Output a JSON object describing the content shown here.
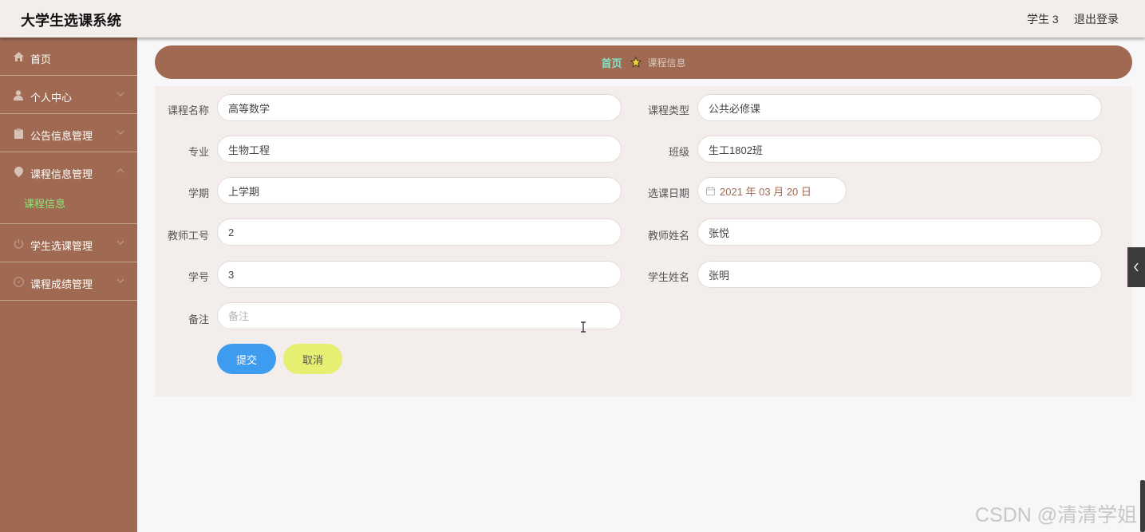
{
  "header": {
    "app_title": "大学生选课系统",
    "user_name": "学生 3",
    "logout_label": "退出登录"
  },
  "sidebar": {
    "items": [
      {
        "label": "首页",
        "icon": "home-icon",
        "has_arrow": false
      },
      {
        "label": "个人中心",
        "icon": "user-icon",
        "has_arrow": true
      },
      {
        "label": "公告信息管理",
        "icon": "clipboard-icon",
        "has_arrow": true
      },
      {
        "label": "课程信息管理",
        "icon": "location-pin-icon",
        "has_arrow": true,
        "expanded": true
      },
      {
        "label": "学生选课管理",
        "icon": "power-icon",
        "has_arrow": true
      },
      {
        "label": "课程成绩管理",
        "icon": "compass-icon",
        "has_arrow": true
      }
    ],
    "submenu": {
      "label": "课程信息",
      "active_color": "#8ee27a"
    }
  },
  "breadcrumb": {
    "home": "首页",
    "current": "课程信息",
    "separator_icon": "star-icon"
  },
  "form": {
    "course_name": {
      "label": "课程名称",
      "value": "高等数学"
    },
    "course_type": {
      "label": "课程类型",
      "value": "公共必修课"
    },
    "major": {
      "label": "专业",
      "value": "生物工程"
    },
    "class_name": {
      "label": "班级",
      "value": "生工1802班"
    },
    "semester": {
      "label": "学期",
      "value": "上学期"
    },
    "select_date": {
      "label": "选课日期",
      "value": "2021 年 03 月 20 日"
    },
    "teacher_id": {
      "label": "教师工号",
      "value": "2"
    },
    "teacher_name": {
      "label": "教师姓名",
      "value": "张悦"
    },
    "student_id": {
      "label": "学号",
      "value": "3"
    },
    "student_name": {
      "label": "学生姓名",
      "value": "张明"
    },
    "remark": {
      "label": "备注",
      "value": "",
      "placeholder": "备注"
    },
    "submit_label": "提交",
    "cancel_label": "取消"
  },
  "watermark": "CSDN @清清学姐",
  "colors": {
    "sidebar": "#a06a52",
    "header": "#f3edeb",
    "breadcrumb_home": "#7fe3c6",
    "submit": "#3d9bf0",
    "cancel": "#e6ef72"
  }
}
